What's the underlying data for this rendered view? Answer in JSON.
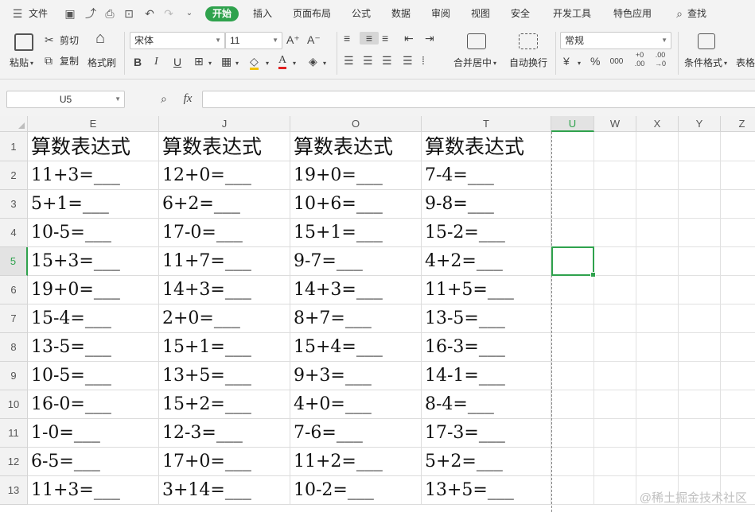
{
  "menu": {
    "file": "文件",
    "tabs": [
      "开始",
      "插入",
      "页面布局",
      "公式",
      "数据",
      "审阅",
      "视图",
      "安全",
      "开发工具",
      "特色应用"
    ],
    "search": "查找"
  },
  "ribbon": {
    "paste": "粘贴",
    "cut": "剪切",
    "copy": "复制",
    "format_painter": "格式刷",
    "font_name": "宋体",
    "font_size": "11",
    "bold": "B",
    "italic": "I",
    "underline": "U",
    "grow_font": "A⁺",
    "shrink_font": "A⁻",
    "merge_center": "合并居中",
    "wrap_text": "自动换行",
    "number_format": "常规",
    "percent": "%",
    "comma": "000",
    "inc_decimal": "+0 .00",
    "dec_decimal": ".00 →0",
    "conditional_format": "条件格式",
    "table_style": "表格"
  },
  "formula_bar": {
    "cell_ref": "U5",
    "fx": "fx",
    "value": ""
  },
  "columns": [
    "E",
    "J",
    "O",
    "T",
    "U",
    "W",
    "X",
    "Y",
    "Z"
  ],
  "selected_column": "U",
  "rows": [
    "1",
    "2",
    "3",
    "4",
    "5",
    "6",
    "7",
    "8",
    "9",
    "10",
    "11",
    "12",
    "13"
  ],
  "selected_row": "5",
  "cells": [
    [
      "算数表达式",
      "算数表达式",
      "算数表达式",
      "算数表达式"
    ],
    [
      "11+3=___",
      "12+0=___",
      "19+0=___",
      "7-4=___"
    ],
    [
      "5+1=___",
      "6+2=___",
      "10+6=___",
      "9-8=___"
    ],
    [
      "10-5=___",
      "17-0=___",
      "15+1=___",
      "15-2=___"
    ],
    [
      "15+3=___",
      "11+7=___",
      "9-7=___",
      "4+2=___"
    ],
    [
      "19+0=___",
      "14+3=___",
      "14+3=___",
      "11+5=___"
    ],
    [
      "15-4=___",
      "2+0=___",
      "8+7=___",
      "13-5=___"
    ],
    [
      "13-5=___",
      "15+1=___",
      "15+4=___",
      "16-3=___"
    ],
    [
      "10-5=___",
      "13+5=___",
      "9+3=___",
      "14-1=___"
    ],
    [
      "16-0=___",
      "15+2=___",
      "4+0=___",
      "8-4=___"
    ],
    [
      "1-0=___",
      "12-3=___",
      "7-6=___",
      "17-3=___"
    ],
    [
      "6-5=___",
      "17+0=___",
      "11+2=___",
      "5+2=___"
    ],
    [
      "11+3=___",
      "3+14=___",
      "10-2=___",
      "13+5=___"
    ]
  ],
  "watermark": "@稀土掘金技术社区",
  "colors": {
    "accent": "#2fa24d",
    "grid": "#dcdcdc",
    "header_bg": "#f2f2f2"
  }
}
